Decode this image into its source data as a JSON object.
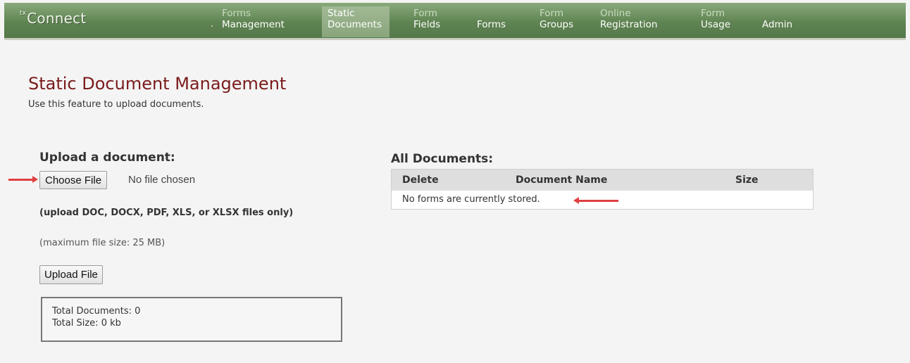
{
  "app": {
    "logo_sup": "tx",
    "logo_text": "Connect"
  },
  "nav": [
    {
      "line1": "Forms",
      "line2": "Management"
    },
    {
      "line1": "Static",
      "line2": "Documents",
      "active": true
    },
    {
      "line1": "Form",
      "line2": "Fields"
    },
    {
      "line1": "",
      "line2": "Forms"
    },
    {
      "line1": "Form",
      "line2": "Groups"
    },
    {
      "line1": "Online",
      "line2": "Registration"
    },
    {
      "line1": "Form",
      "line2": "Usage"
    },
    {
      "line1": "",
      "line2": "Admin"
    }
  ],
  "page": {
    "title": "Static Document Management",
    "subtitle": "Use this feature to upload documents."
  },
  "upload": {
    "heading": "Upload a document:",
    "choose_label": "Choose File",
    "no_file_text": "No file chosen",
    "allowed_note": "(upload DOC, DOCX, PDF, XLS, or XLSX files only)",
    "max_note": "(maximum file size: 25 MB)",
    "upload_label": "Upload File"
  },
  "totals": {
    "documents": "Total Documents: 0",
    "size": "Total Size: 0 kb"
  },
  "documents": {
    "heading": "All Documents:",
    "columns": [
      "Delete",
      "Document Name",
      "Size"
    ],
    "empty_message": "No forms are currently stored."
  },
  "colors": {
    "nav_green": "#5f8452",
    "title_maroon": "#7a1b1b",
    "annotation_arrow": "#e04040"
  }
}
